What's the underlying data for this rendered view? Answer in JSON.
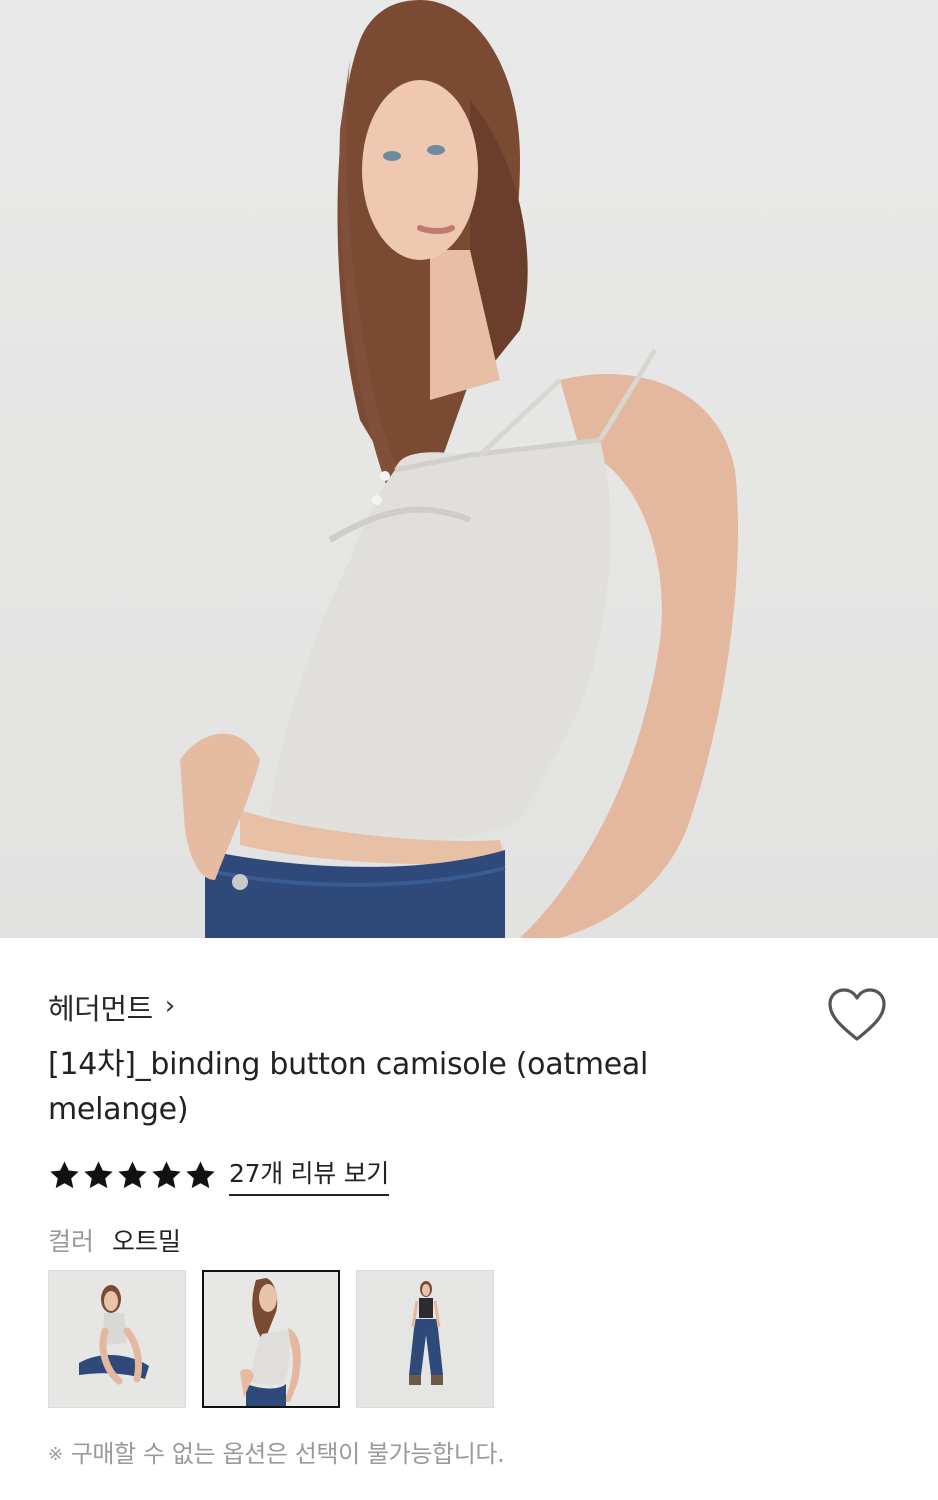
{
  "product": {
    "image_alt": "model wearing oatmeal melange camisole",
    "brand": "헤더먼트",
    "brand_chevron": "›",
    "title": "[14차]_binding button camisole (oatmeal melange)",
    "rating": 5,
    "rating_max": 5,
    "review_link": "27개 리뷰 보기",
    "wishlist_icon": "heart-outline-icon"
  },
  "options": {
    "color_label": "컬러",
    "color_value": "오트밀",
    "thumbnails": [
      {
        "name": "sitting-pose",
        "selected": false
      },
      {
        "name": "side-pose",
        "selected": true
      },
      {
        "name": "full-body-pose",
        "selected": false
      }
    ]
  },
  "notice": {
    "mark": "※",
    "text": "구매할 수 없는 옵션은 선택이 불가능합니다."
  },
  "colors": {
    "text_primary": "#222222",
    "text_muted": "#9a9a9a",
    "selected_border": "#111111",
    "star": "#111111"
  }
}
